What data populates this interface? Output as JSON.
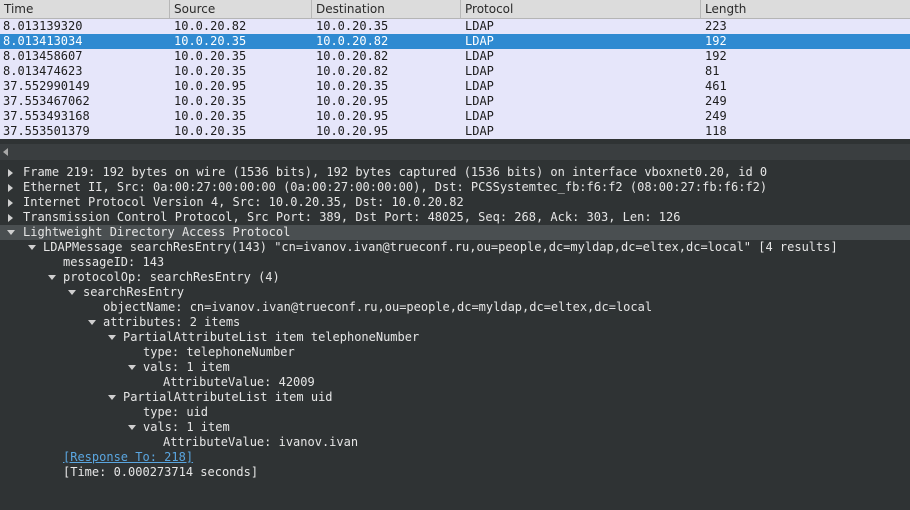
{
  "packet_list": {
    "columns": [
      "Time",
      "Source",
      "Destination",
      "Protocol",
      "Length"
    ],
    "rows": [
      {
        "time": "8.013139320",
        "source": "10.0.20.82",
        "destination": "10.0.20.35",
        "protocol": "LDAP",
        "length": "223"
      },
      {
        "time": "8.013413034",
        "source": "10.0.20.35",
        "destination": "10.0.20.82",
        "protocol": "LDAP",
        "length": "192"
      },
      {
        "time": "8.013458607",
        "source": "10.0.20.35",
        "destination": "10.0.20.82",
        "protocol": "LDAP",
        "length": "192"
      },
      {
        "time": "8.013474623",
        "source": "10.0.20.35",
        "destination": "10.0.20.82",
        "protocol": "LDAP",
        "length": "81"
      },
      {
        "time": "37.552990149",
        "source": "10.0.20.95",
        "destination": "10.0.20.35",
        "protocol": "LDAP",
        "length": "461"
      },
      {
        "time": "37.553467062",
        "source": "10.0.20.35",
        "destination": "10.0.20.95",
        "protocol": "LDAP",
        "length": "249"
      },
      {
        "time": "37.553493168",
        "source": "10.0.20.35",
        "destination": "10.0.20.95",
        "protocol": "LDAP",
        "length": "249"
      },
      {
        "time": "37.553501379",
        "source": "10.0.20.35",
        "destination": "10.0.20.95",
        "protocol": "LDAP",
        "length": "118"
      }
    ]
  },
  "details": {
    "frame": "Frame 219: 192 bytes on wire (1536 bits), 192 bytes captured (1536 bits) on interface vboxnet0.20, id 0",
    "ethernet": "Ethernet II, Src: 0a:00:27:00:00:00 (0a:00:27:00:00:00), Dst: PCSSystemtec_fb:f6:f2 (08:00:27:fb:f6:f2)",
    "ip": "Internet Protocol Version 4, Src: 10.0.20.35, Dst: 10.0.20.82",
    "tcp": "Transmission Control Protocol, Src Port: 389, Dst Port: 48025, Seq: 268, Ack: 303, Len: 126",
    "ldap": "Lightweight Directory Access Protocol",
    "ldap_message": "LDAPMessage searchResEntry(143) \"cn=ivanov.ivan@trueconf.ru,ou=people,dc=myldap,dc=eltex,dc=local\" [4 results]",
    "message_id": "messageID: 143",
    "protocol_op": "protocolOp: searchResEntry (4)",
    "search_res_entry": "searchResEntry",
    "object_name": "objectName: cn=ivanov.ivan@trueconf.ru,ou=people,dc=myldap,dc=eltex,dc=local",
    "attributes": "attributes: 2 items",
    "attr1": "PartialAttributeList item telephoneNumber",
    "attr1_type": "type: telephoneNumber",
    "attr1_vals": "vals: 1 item",
    "attr1_value": "AttributeValue: 42009",
    "attr2": "PartialAttributeList item uid",
    "attr2_type": "type: uid",
    "attr2_vals": "vals: 1 item",
    "attr2_value": "AttributeValue: ivanov.ivan",
    "response_to": "[Response To: 218]",
    "time": "[Time: 0.000273714 seconds]"
  },
  "colors": {
    "row_bg": "#e6e6fa",
    "selected_row": "#2f8ad1",
    "tree_bg": "#2f3334",
    "link": "#5aa6e0"
  }
}
